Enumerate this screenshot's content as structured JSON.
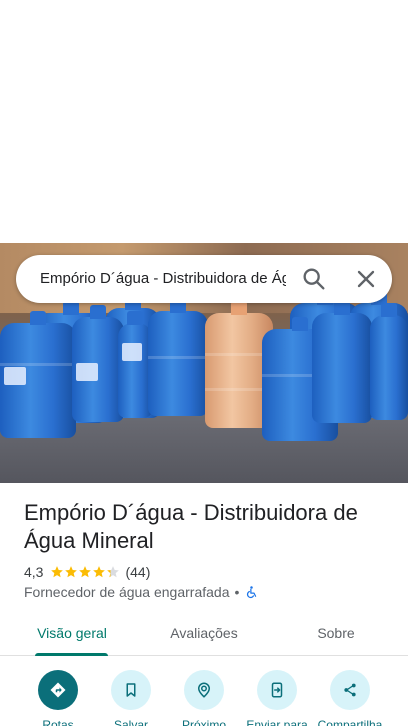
{
  "search": {
    "query": "Empório D´água - Distribuidora de Água Mineral"
  },
  "place": {
    "title": "Empório D´água - Distribuidora de Água Mineral",
    "rating": "4,3",
    "stars": 4.3,
    "review_count": "(44)",
    "category": "Fornecedor de água engarrafada",
    "separator": "•",
    "accessibility_icon": "wheelchair-icon"
  },
  "tabs": [
    {
      "label": "Visão geral",
      "active": true
    },
    {
      "label": "Avaliações",
      "active": false
    },
    {
      "label": "Sobre",
      "active": false
    }
  ],
  "actions": [
    {
      "label": "Rotas",
      "icon": "directions-icon"
    },
    {
      "label": "Salvar",
      "icon": "bookmark-icon"
    },
    {
      "label": "Próximo",
      "icon": "nearby-icon"
    },
    {
      "label": "Enviar para",
      "icon": "send-to-phone-icon"
    },
    {
      "label": "Compartilha",
      "icon": "share-icon"
    }
  ],
  "colors": {
    "accent": "#00796b",
    "action_bg": "#d7f3f9",
    "action_primary": "#0b6f7a",
    "star": "#fbbc04",
    "accessibility": "#1a73e8"
  }
}
